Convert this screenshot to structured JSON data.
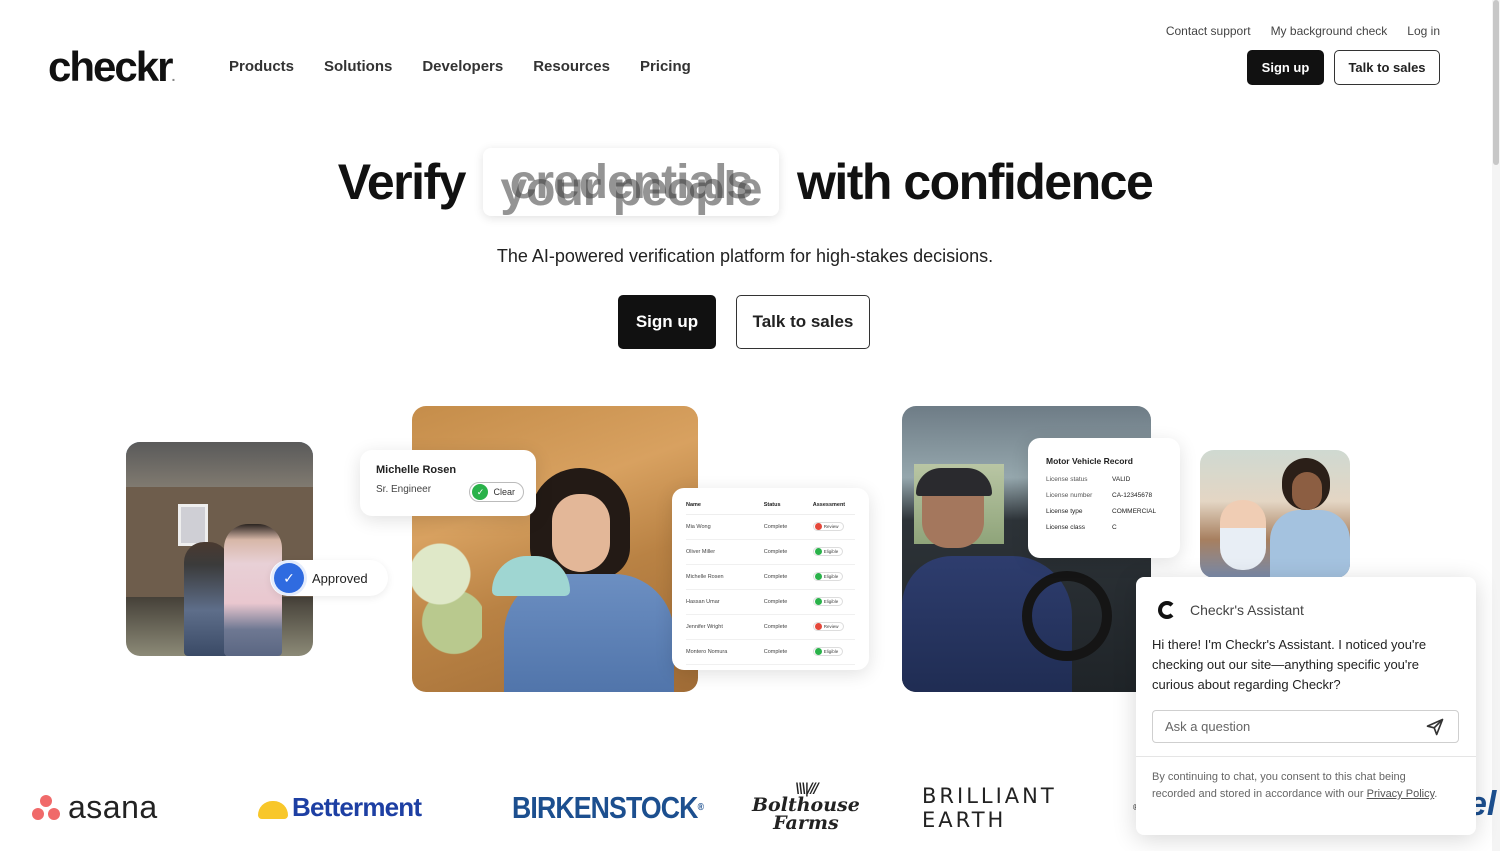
{
  "header": {
    "logo": "checkr",
    "logo_mark": ".",
    "utility_links": [
      "Contact support",
      "My background check",
      "Log in"
    ],
    "nav": [
      "Products",
      "Solutions",
      "Developers",
      "Resources",
      "Pricing"
    ],
    "signup_label": "Sign up",
    "talk_label": "Talk to sales"
  },
  "hero": {
    "prefix": "Verify",
    "rotating_word_current": "credentials",
    "rotating_word_next": "your people",
    "suffix": "with confidence",
    "subtitle": "The AI-powered verification platform for high-stakes decisions.",
    "signup_label": "Sign up",
    "talk_label": "Talk to sales"
  },
  "cards": {
    "approved": {
      "label": "Approved",
      "icon": "check-badge-icon"
    },
    "profile": {
      "name": "Michelle Rosen",
      "role": "Sr. Engineer",
      "status": "Clear"
    },
    "table": {
      "headers": [
        "Name",
        "Status",
        "Assessment"
      ],
      "rows": [
        {
          "name": "Mia Wong",
          "status": "Complete",
          "assessment": "Review",
          "color": "#e5483b"
        },
        {
          "name": "Oliver Miller",
          "status": "Complete",
          "assessment": "Eligible",
          "color": "#2ab24a"
        },
        {
          "name": "Michelle Rosen",
          "status": "Complete",
          "assessment": "Eligible",
          "color": "#2ab24a"
        },
        {
          "name": "Hassan Umar",
          "status": "Complete",
          "assessment": "Eligible",
          "color": "#2ab24a"
        },
        {
          "name": "Jennifer Wright",
          "status": "Complete",
          "assessment": "Review",
          "color": "#e5483b"
        },
        {
          "name": "Montero Nomura",
          "status": "Complete",
          "assessment": "Eligible",
          "color": "#2ab24a"
        }
      ]
    },
    "mvr": {
      "title": "Motor Vehicle Record",
      "rows": [
        {
          "k": "License status",
          "v": "VALID"
        },
        {
          "k": "License number",
          "v": "CA-12345678"
        },
        {
          "k": "License type",
          "v": "COMMERCIAL"
        },
        {
          "k": "License class",
          "v": "C"
        }
      ]
    }
  },
  "logos": {
    "asana": "asana",
    "betterment": "Betterment",
    "birkenstock": "BIRKENSTOCK",
    "bolthouse_line1": "Bolthouse",
    "bolthouse_line2": "Farms",
    "brilliant": "BRILLIANT EARTH",
    "partial": "el"
  },
  "chat": {
    "title": "Checkr's Assistant",
    "message": "Hi there! I'm Checkr's Assistant. I noticed you're checking out our site—anything specific you're curious about regarding Checkr?",
    "placeholder": "Ask a question",
    "consent_text": "By continuing to chat, you consent to this chat being recorded and stored in accordance with our ",
    "consent_link": "Privacy Policy",
    "consent_end": "."
  },
  "colors": {
    "primary_dark": "#111111",
    "check_blue": "#2f6be0",
    "status_green": "#2ab24a",
    "status_red": "#e5483b"
  }
}
